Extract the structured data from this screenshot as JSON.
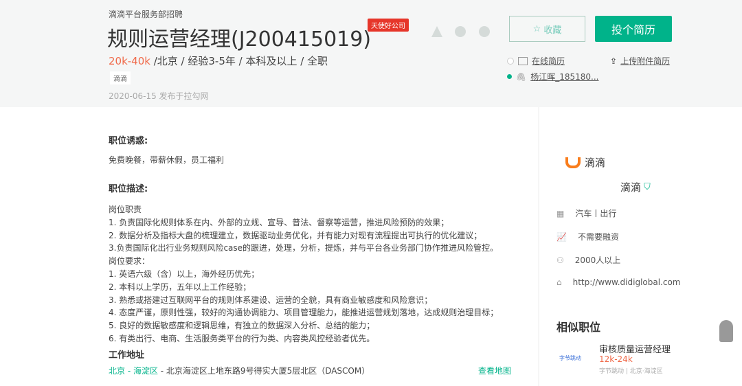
{
  "header": {
    "department": "滴滴平台服务部招聘",
    "title": "规则运营经理(J200415019)",
    "badge": "天使好公司",
    "salary": "20k-40k",
    "meta": " /北京 / 经验3-5年 / 本科及以上 / 全职",
    "tag": "滴滴",
    "date": "2020-06-15 发布于拉勾网"
  },
  "actions": {
    "favorite": "收藏",
    "apply": "投个简历",
    "online_resume": "在线简历",
    "upload_resume": "上传附件简历",
    "attachment": "杨江晖_185180..."
  },
  "main": {
    "perks_title": "职位诱惑:",
    "perks": "免费晚餐，带薪休假，员工福利",
    "desc_title": "职位描述:",
    "desc_lines": [
      "岗位职责",
      "1. 负责国际化规则体系在内、外部的立规、宣导、普法、督察等运营，推进风险预防的效果；",
      "2. 数据分析及指标大盘的梳理建立，数据驱动业务优化，并有能力对现有流程提出可执行的优化建议；",
      "3.负责国际化出行业务规则风险case的跟进，处理，分析，提炼，并与平台各业务部门协作推进风险管控。",
      "岗位要求：",
      "1. 英语六级（含）以上，海外经历优先；",
      "2. 本科以上学历，五年以上工作经验；",
      "3. 熟悉或搭建过互联网平台的规则体系建设、运营的全貌，具有商业敏感度和风险意识；",
      "4. 态度严谨，原则性强，较好的沟通协调能力、项目管理能力，能推进运营规划落地，达成规则治理目标；",
      "5. 良好的数据敏感度和逻辑思维，有独立的数据深入分析、总结的能力；",
      "6. 有类出行、电商、生活服务类平台的行为类、内容类风控经验者优先。"
    ],
    "addr_title": "工作地址",
    "addr_city": "北京 - 海淀区",
    "addr_detail": " - 北京海淀区上地东路9号得实大厦5层北区（DASCOM）",
    "map_link": "查看地图"
  },
  "company": {
    "logo_text": "滴滴",
    "name": "滴滴",
    "industry": "汽车丨出行",
    "funding": "不需要融资",
    "size": "2000人以上",
    "site": "http://www.didiglobal.com",
    "accent": "#f97d1c"
  },
  "similar": {
    "title": "相似职位",
    "items": [
      {
        "logo": "字节跳动",
        "title": "审核质量运营经理",
        "salary": "12k-24k",
        "company": "字节跳动 | 北京·海淀区"
      }
    ]
  }
}
